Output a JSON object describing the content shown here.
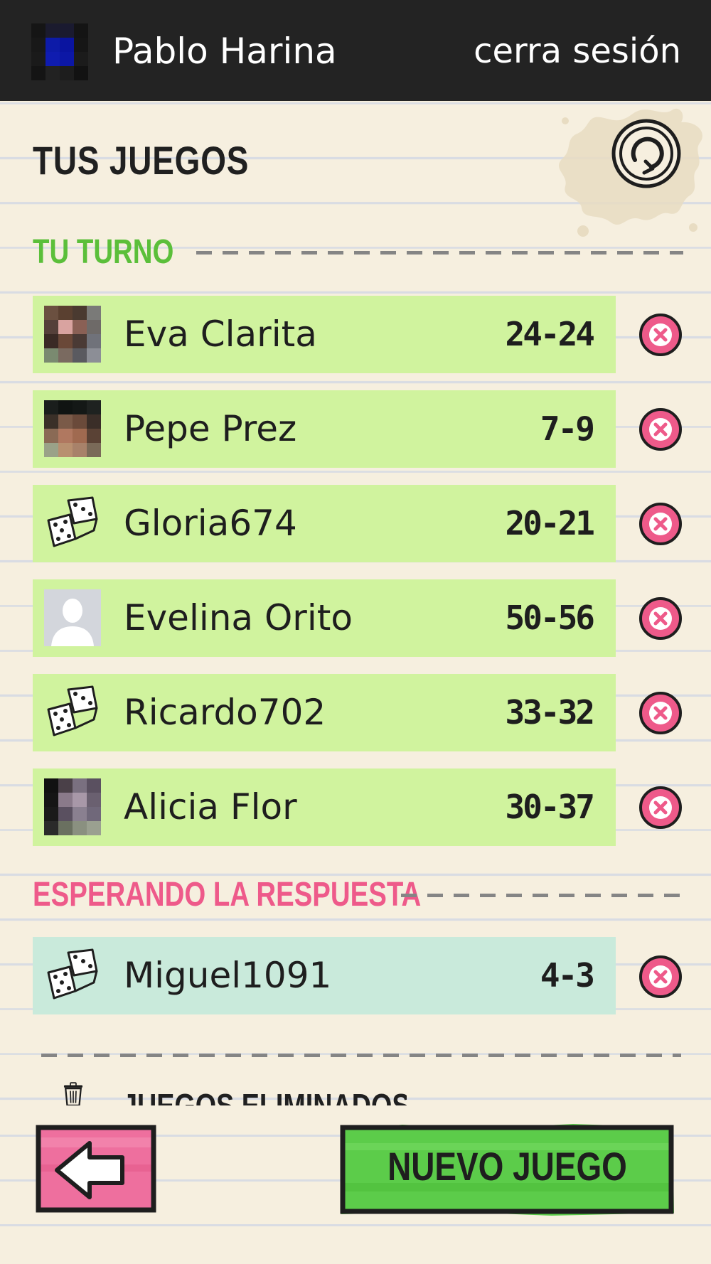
{
  "header": {
    "username": "Pablo Harina",
    "logout_label": "cerra sesión"
  },
  "page_title": "TUS JUEGOS",
  "sections": {
    "your_turn": {
      "label": "TU TURNO",
      "color": "#5bbf3a"
    },
    "waiting": {
      "label": "ESPERANDO LA RESPUESTA",
      "color": "#ee5a8a"
    }
  },
  "games_your_turn": [
    {
      "name": "Eva Clarita",
      "score": "24-24",
      "avatar": "photo"
    },
    {
      "name": "Pepe Prez",
      "score": "7-9",
      "avatar": "photo"
    },
    {
      "name": "Gloria674",
      "score": "20-21",
      "avatar": "dice-icon"
    },
    {
      "name": "Evelina Orito",
      "score": "50-56",
      "avatar": "default-person-icon"
    },
    {
      "name": "Ricardo702",
      "score": "33-32",
      "avatar": "dice-icon"
    },
    {
      "name": "Alicia Flor",
      "score": "30-37",
      "avatar": "photo"
    }
  ],
  "games_waiting": [
    {
      "name": "Miguel1091",
      "score": "4-3",
      "avatar": "dice-icon"
    }
  ],
  "deleted_games_label": "JUEGOS ELIMINADOS",
  "buttons": {
    "back_icon": "arrow-left-icon",
    "new_game_label": "NUEVO JUEGO"
  },
  "colors": {
    "turn_row": "#d0f39e",
    "wait_row": "#c9eadb",
    "delete_button": "#ee5a8a",
    "new_game_button": "#5ccc4a",
    "back_button": "#ee6f9e",
    "top_bar": "#232323",
    "paper": "#f6efdf"
  }
}
